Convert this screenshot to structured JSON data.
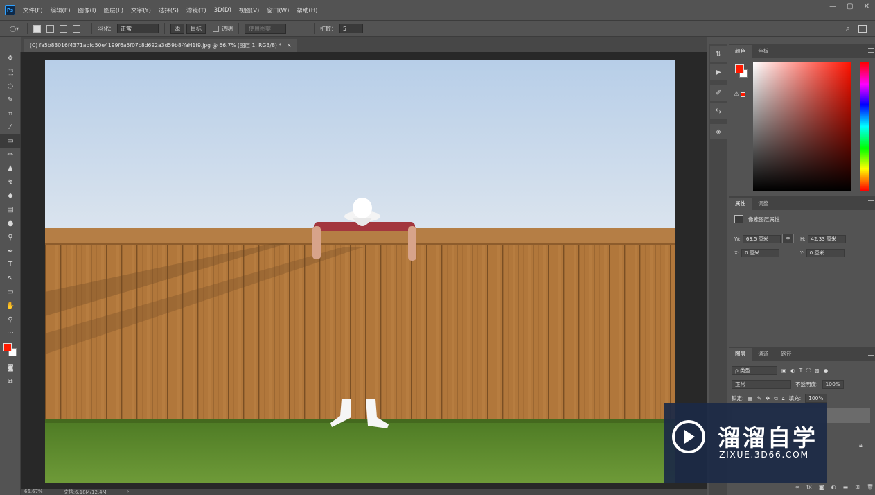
{
  "app": {
    "logo": "Ps"
  },
  "menu": [
    "文件(F)",
    "编辑(E)",
    "图像(I)",
    "图层(L)",
    "文字(Y)",
    "选择(S)",
    "滤镜(T)",
    "3D(D)",
    "视图(V)",
    "窗口(W)",
    "帮助(H)"
  ],
  "window_controls": [
    "—",
    "▢",
    "✕"
  ],
  "options": {
    "feather_label": "羽化：",
    "style_value": "正常",
    "add_label": "添",
    "target_label": "目标",
    "transparent_label": "透明",
    "use_pattern_label": "使用图案",
    "diffusion_label": "扩散：",
    "diffusion_value": "5"
  },
  "document": {
    "tab_title": "(C) fa5b83016f4371abfd50e4199f6a5f07c8d692a3d59b8-YaH1f9.jpg @ 66.7% (图层 1, RGB/8) *",
    "close": "×"
  },
  "statusbar": {
    "zoom": "66.67%",
    "doc_info": "文档:6.18M/12.4M",
    "arrow": "›"
  },
  "color_panel": {
    "tabs": [
      "颜色",
      "色板"
    ],
    "fg_color": "#ff1a00",
    "bg_color": "#ffffff"
  },
  "properties_panel": {
    "tabs": [
      "属性",
      "调整"
    ],
    "type_label": "像素图层属性",
    "w_label": "W:",
    "w_value": "63.5 厘米",
    "h_label": "H:",
    "h_value": "42.33 厘米",
    "x_label": "X:",
    "x_value": "0 厘米",
    "y_label": "Y:",
    "y_value": "0 厘米",
    "link_glyph": "∞"
  },
  "layers_panel": {
    "tabs": [
      "图层",
      "通道",
      "路径"
    ],
    "filter_value": "ρ 类型",
    "blend_mode": "正常",
    "opacity_label": "不透明度:",
    "opacity_value": "100%",
    "lock_label": "锁定:",
    "fill_label": "填充:",
    "fill_value": "100%"
  },
  "watermark": {
    "title": "溜溜自学",
    "url": "ZIXUE.3D66.COM"
  }
}
